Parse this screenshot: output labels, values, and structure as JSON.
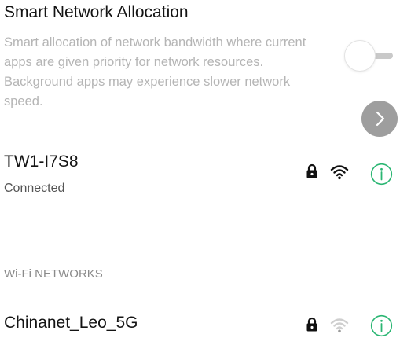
{
  "smart_network": {
    "title": "Smart Network Allocation",
    "description": "Smart allocation of network bandwidth where current apps are given priority for network resources. Background apps may experience slower network speed.",
    "toggle_on": false
  },
  "connected_network": {
    "name": "TW1-I7S8",
    "status": "Connected",
    "secured": true,
    "signal_icon": "wifi-full-icon",
    "info_icon": "info-icon"
  },
  "section_header": "Wi-Fi NETWORKS",
  "networks": [
    {
      "name": "Chinanet_Leo_5G",
      "secured": true,
      "signal_icon": "wifi-weak-icon",
      "info_icon": "info-icon"
    }
  ],
  "colors": {
    "accent_green": "#2bb673",
    "fab_gray": "#9e9e9e",
    "description_gray": "#b5b5b5"
  }
}
